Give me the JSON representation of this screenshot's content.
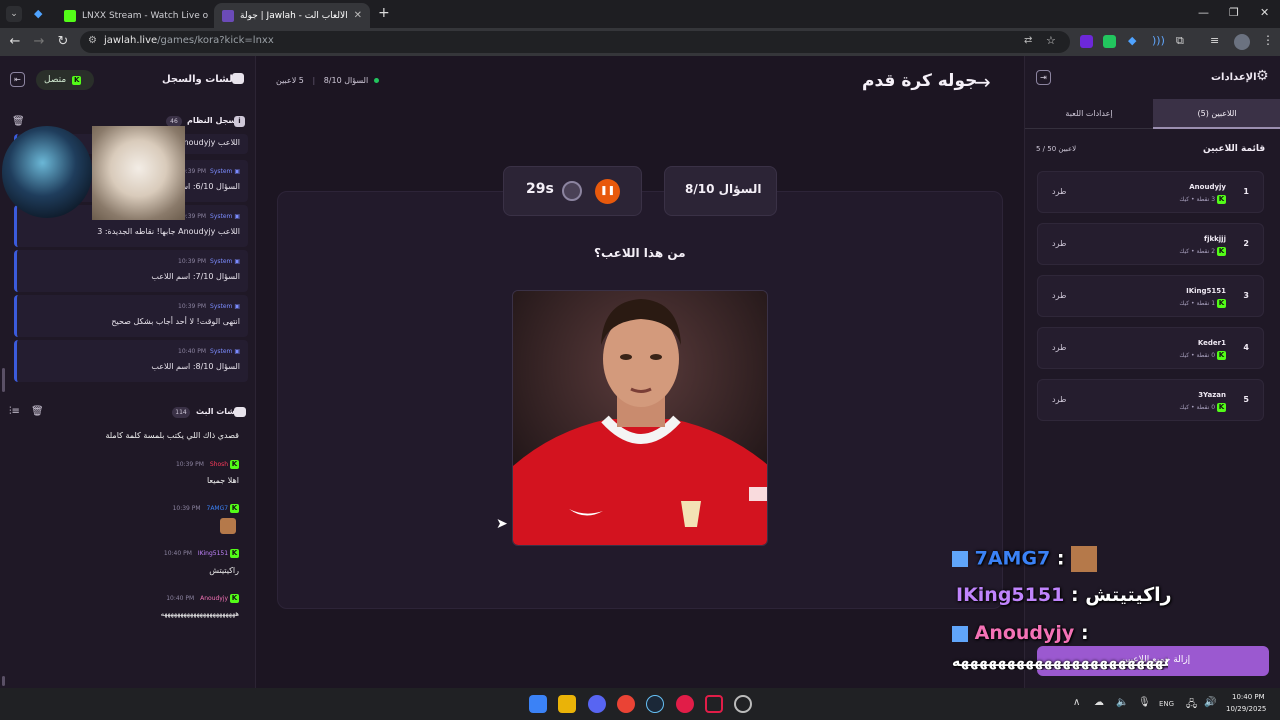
{
  "browser": {
    "tabs": [
      {
        "title": "LNXX Stream - Watch Live o"
      },
      {
        "title": "جولة | Jawlah - منصة الألعاب الت..."
      }
    ],
    "url_host": "jawlah.live",
    "url_path": "/games/kora?kick=lnxx"
  },
  "left": {
    "title": "الشات والسجل",
    "status": "متصل",
    "log_title": "سجل النظام",
    "log_count": "46",
    "first_line": "اللاعب Anoudyjy",
    "log": [
      {
        "time": "10:39 PM",
        "who": "System",
        "text": "السؤال 6/10: اسم اللاعب"
      },
      {
        "time": "10:39 PM",
        "who": "System",
        "text": "اللاعب Anoudyjy جابها! نقاطه الجديدة: 3"
      },
      {
        "time": "10:39 PM",
        "who": "System",
        "text": "السؤال 7/10: اسم اللاعب"
      },
      {
        "time": "10:39 PM",
        "who": "System",
        "text": "انتهى الوقت! لا أحد أجاب بشكل صحيح"
      },
      {
        "time": "10:40 PM",
        "who": "System",
        "text": "السؤال 8/10: اسم اللاعب"
      }
    ],
    "chat_title": "شات البث",
    "chat_count": "114",
    "chat_first": "قصدي ذاك اللي يكتب بلمسة كلمة كاملة",
    "chat": [
      {
        "time": "10:39 PM",
        "user": "Shosh",
        "color": "#ff3b5c",
        "text": "اهلا جميعا"
      },
      {
        "time": "10:39 PM",
        "user": "7AMG7",
        "color": "#3b82f6",
        "text": ""
      },
      {
        "time": "10:40 PM",
        "user": "IKing5151",
        "color": "#c084fc",
        "text": "راكيتيتش"
      },
      {
        "time": "10:40 PM",
        "user": "Anoudyjy",
        "color": "#f472b6",
        "text": "هههههههههههههههههههههههه"
      }
    ]
  },
  "center": {
    "players_label": "5 لاعبين",
    "question_label": "السؤال 8/10",
    "title": "جوله كرة قدم",
    "timer": "29s",
    "question_pill": "السؤال 8/10",
    "question": "من هذا اللاعب؟"
  },
  "right": {
    "title": "الإعدادات",
    "tab_players": "اللاعبين (5)",
    "tab_settings": "إعدادات اللعبة",
    "list_title": "قائمة اللاعبين",
    "list_count": "5 / 50 لاعبين",
    "kick_label": "طرد",
    "players": [
      {
        "rank": "1",
        "name": "Anoudyjy",
        "info": "3 نقطة • كيك"
      },
      {
        "rank": "2",
        "name": "fjkkjjj",
        "info": "2 نقطة • كيك"
      },
      {
        "rank": "3",
        "name": "IKing5151",
        "info": "1 نقطة • كيك"
      },
      {
        "rank": "4",
        "name": "Keder1",
        "info": "0 نقطة • كيك"
      },
      {
        "rank": "5",
        "name": "3Yazan",
        "info": "0 نقطة • كيك"
      }
    ],
    "remove_all": "إزالة جميع اللاعبين"
  },
  "overlay": {
    "line1_user": "7AMG7",
    "line2_user": "IKing5151",
    "line2_text": "راكيتيتش",
    "line3_user": "Anoudyjy",
    "line4_text": "هههههههههههههههههههههههه",
    "sep": ":"
  },
  "taskbar": {
    "lang": "ENG",
    "time": "10:40 PM",
    "date": "10/29/2025"
  },
  "colors": {
    "accent_kick": "#53fc18",
    "pause_button": "#e8590c",
    "remove_button": "#9b59d0"
  }
}
